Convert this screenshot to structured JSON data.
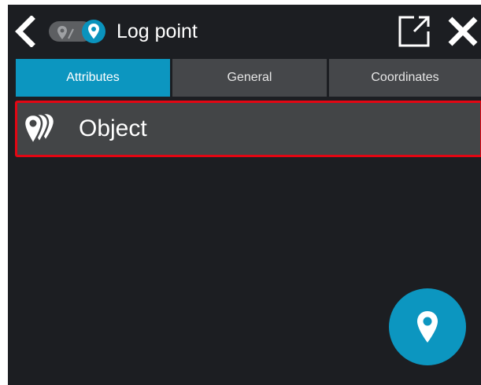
{
  "header": {
    "title": "Log point",
    "back_icon": "chevron-left-icon",
    "mode_toggle_icon": "location-pin-icon",
    "popout_icon": "external-link-icon",
    "close_icon": "close-icon"
  },
  "tabs": [
    {
      "label": "Attributes",
      "active": true
    },
    {
      "label": "General",
      "active": false
    },
    {
      "label": "Coordinates",
      "active": false
    }
  ],
  "object_row": {
    "label": "Object",
    "icon": "multiple-pins-icon",
    "highlight_color": "#e30613"
  },
  "fab": {
    "icon": "location-pin-icon"
  },
  "colors": {
    "accent": "#0c96c0",
    "background": "#1c1e22",
    "tab_inactive": "#45474a",
    "row_background": "#434547"
  }
}
